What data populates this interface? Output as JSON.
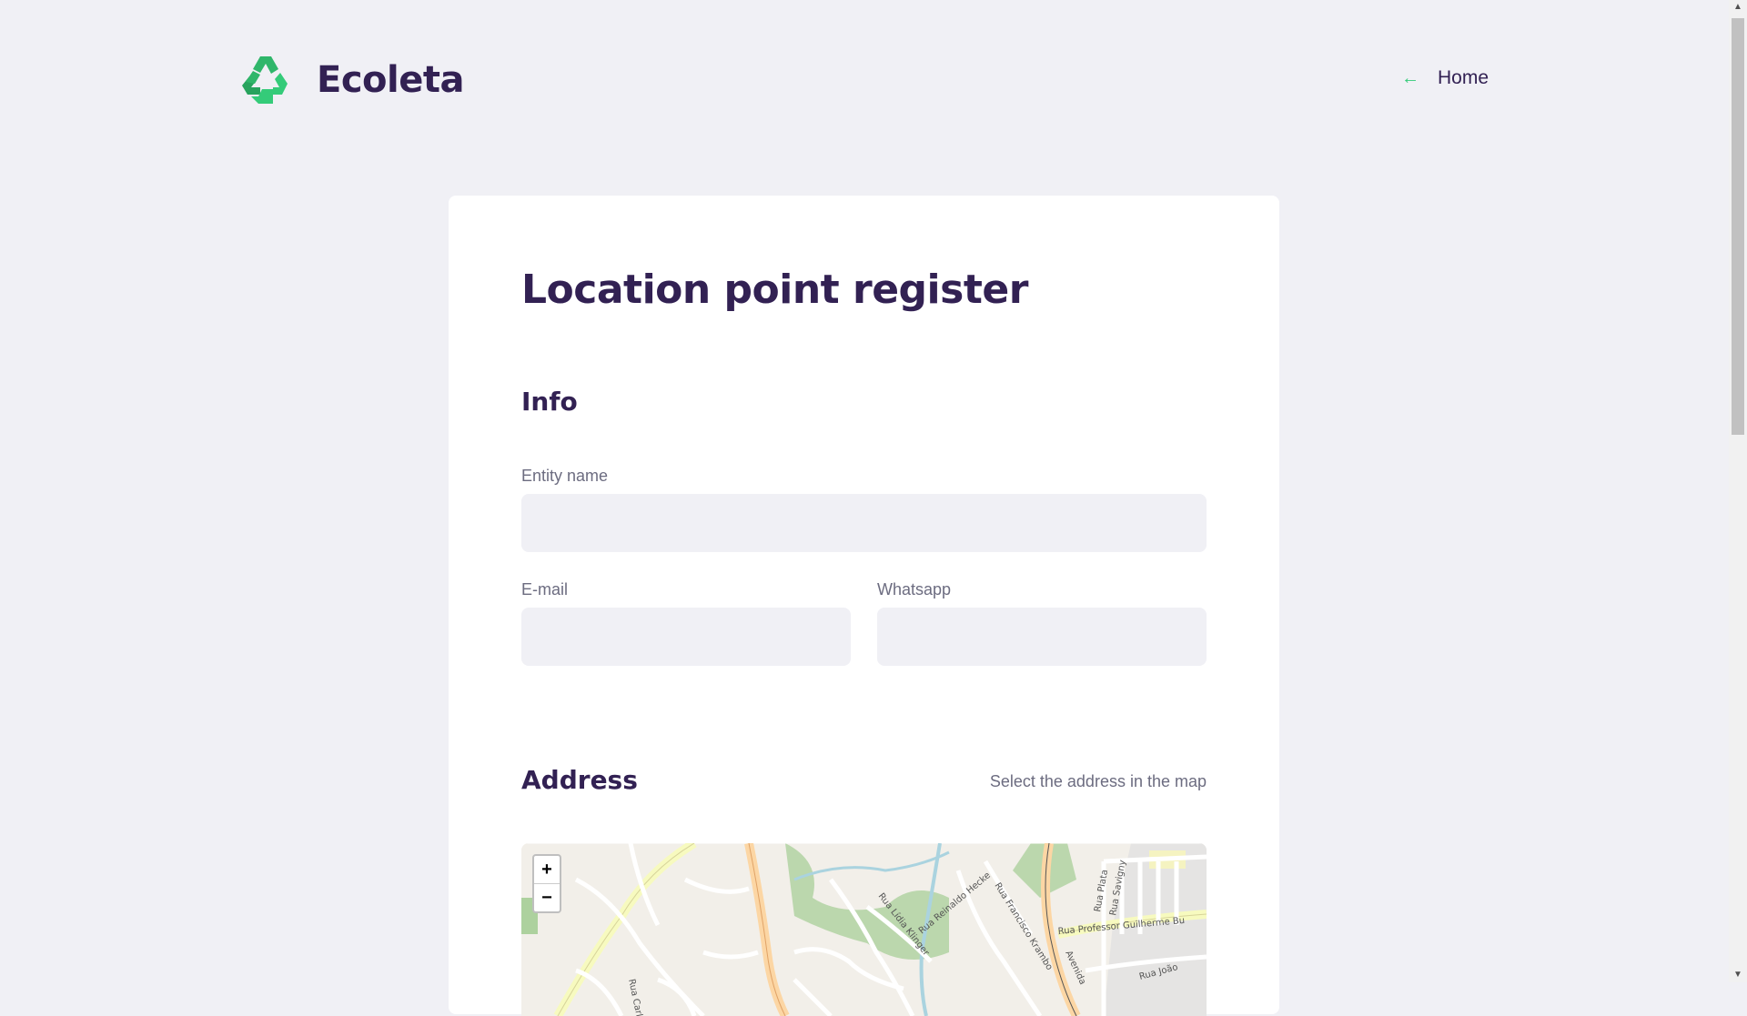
{
  "header": {
    "app_name": "Ecoleta",
    "logo_icon": "recycle-icon",
    "home_link": {
      "icon": "arrow-left-icon",
      "label": "Home"
    }
  },
  "page": {
    "title": "Location point register"
  },
  "info": {
    "title": "Info",
    "entity_name": {
      "label": "Entity name",
      "value": "",
      "placeholder": ""
    },
    "email": {
      "label": "E-mail",
      "value": "",
      "placeholder": ""
    },
    "whatsapp": {
      "label": "Whatsapp",
      "value": "",
      "placeholder": ""
    }
  },
  "address": {
    "title": "Address",
    "hint": "Select the address in the map",
    "map": {
      "zoom_in": "+",
      "zoom_out": "−",
      "street_labels": [
        "Rua Carla Kuche",
        "Rua Lídia Klinger",
        "Rua Reinaldo Hecke",
        "Rua Francisco Krambo",
        "Rua Professor Guilherme Bu",
        "Rua Savigny",
        "Rua Plata",
        "Avenida",
        "Rua João"
      ]
    }
  },
  "colors": {
    "primary": "#34cb79",
    "title": "#322153",
    "text": "#6c6c80",
    "background": "#f0f0f5",
    "card": "#ffffff"
  }
}
